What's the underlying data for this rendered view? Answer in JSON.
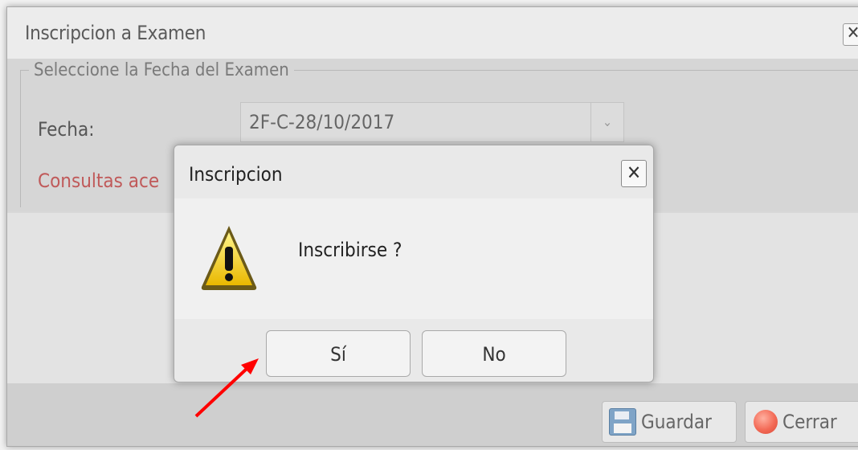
{
  "window": {
    "title": "Inscripcion a Examen",
    "close_glyph": "✕",
    "fieldset_legend": "Seleccione la Fecha del Examen",
    "fecha_label": "Fecha:",
    "fecha_value": "2F-C-28/10/2017",
    "combo_icon": "chevron-down",
    "consultas_text": "Consultas ace",
    "footer": {
      "guardar_label": "Guardar",
      "cerrar_label": "Cerrar"
    }
  },
  "dialog": {
    "title": "Inscripcion",
    "close_glyph": "✕",
    "message": "Inscribirse ?",
    "icon": "warning-icon",
    "yes_label": "Sí",
    "no_label": "No"
  },
  "annotation": {
    "arrow_color": "#ff0000"
  },
  "colors": {
    "warning_text": "#c05a5a",
    "window_bg": "#d8d8d8"
  }
}
